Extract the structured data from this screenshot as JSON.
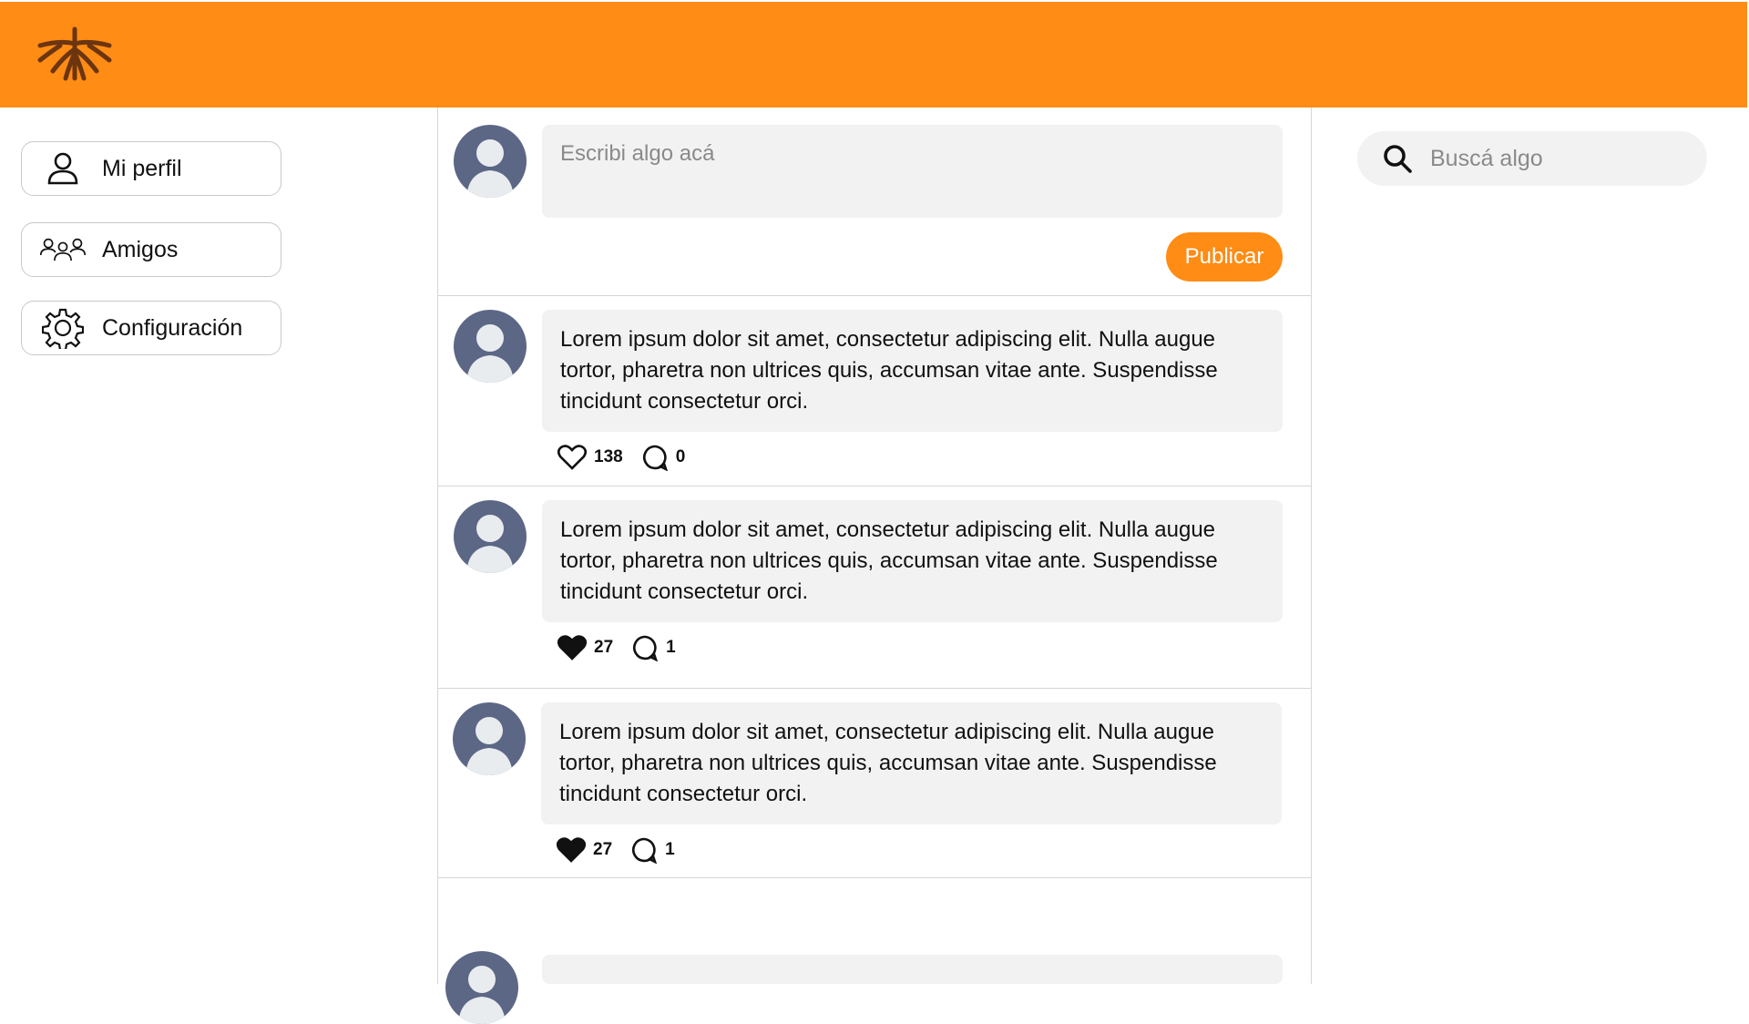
{
  "header": {
    "logo_icon": "tree-roots-logo",
    "background_color": "#ff8c14"
  },
  "sidebar": {
    "items": [
      {
        "label": "Mi perfil",
        "icon": "user-icon"
      },
      {
        "label": "Amigos",
        "icon": "users-group-icon"
      },
      {
        "label": "Configuración",
        "icon": "gear-icon"
      }
    ]
  },
  "composer": {
    "placeholder": "Escribi algo acá",
    "publish_label": "Publicar"
  },
  "posts": [
    {
      "text": "Lorem ipsum dolor sit amet, consectetur adipiscing elit. Nulla augue tortor, pharetra non ultrices quis, accumsan vitae ante. Suspendisse tincidunt consectetur orci.",
      "likes": "138",
      "liked": false,
      "comments": "0"
    },
    {
      "text": "Lorem ipsum dolor sit amet, consectetur adipiscing elit. Nulla augue tortor, pharetra non ultrices quis, accumsan vitae ante. Suspendisse tincidunt consectetur orci.",
      "likes": "27",
      "liked": true,
      "comments": "1"
    },
    {
      "text": "Lorem ipsum dolor sit amet, consectetur adipiscing elit. Nulla augue tortor, pharetra non ultrices quis, accumsan vitae ante. Suspendisse tincidunt consectetur orci.",
      "likes": "27",
      "liked": true,
      "comments": "1"
    },
    {
      "text": "",
      "likes": "",
      "liked": false,
      "comments": ""
    }
  ],
  "search": {
    "placeholder": "Buscá algo",
    "icon": "search-icon"
  },
  "colors": {
    "accent": "#ff8c14",
    "avatar": "#5b6785",
    "card_bg": "#f2f2f2"
  }
}
